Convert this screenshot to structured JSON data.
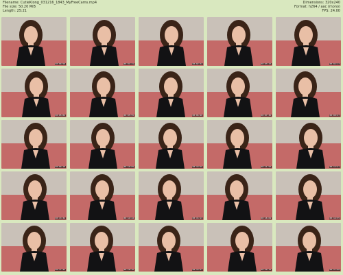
{
  "header": {
    "filename_label": "Filename:",
    "filename": "CutieKiong_031216_1843_MyFreeCams.mp4",
    "filesize_label": "File size:",
    "filesize": "50.20 MiB",
    "length_label": "Length:",
    "length": "25:21",
    "dimensions_label": "Dimensions:",
    "dimensions": "320x240",
    "format_label": "Format:",
    "format": "h264 / aac (mono)",
    "fps_label": "FPS:",
    "fps": "24.00"
  },
  "colors": {
    "background": "#d9e8bf",
    "wall": "#c9c1b8",
    "sofa": "#c46a68",
    "hair": "#3a2418",
    "skin": "#e9bfa6",
    "top": "#121214"
  },
  "thumbnails": [
    {
      "timestamp": "00:00:50"
    },
    {
      "timestamp": "00:01:41"
    },
    {
      "timestamp": "00:02:32"
    },
    {
      "timestamp": "00:03:23"
    },
    {
      "timestamp": "00:04:13"
    },
    {
      "timestamp": "00:05:04"
    },
    {
      "timestamp": "00:05:55"
    },
    {
      "timestamp": "00:06:46"
    },
    {
      "timestamp": "00:07:36"
    },
    {
      "timestamp": "00:08:27"
    },
    {
      "timestamp": "00:09:18"
    },
    {
      "timestamp": "00:10:09"
    },
    {
      "timestamp": "00:10:59"
    },
    {
      "timestamp": "00:11:50"
    },
    {
      "timestamp": "00:12:41"
    },
    {
      "timestamp": "00:13:32"
    },
    {
      "timestamp": "00:14:22"
    },
    {
      "timestamp": "00:15:13"
    },
    {
      "timestamp": "00:16:04"
    },
    {
      "timestamp": "00:16:55"
    },
    {
      "timestamp": "00:17:45"
    },
    {
      "timestamp": "00:18:36"
    },
    {
      "timestamp": "00:19:27"
    },
    {
      "timestamp": "00:20:18"
    },
    {
      "timestamp": "00:21:08"
    }
  ]
}
